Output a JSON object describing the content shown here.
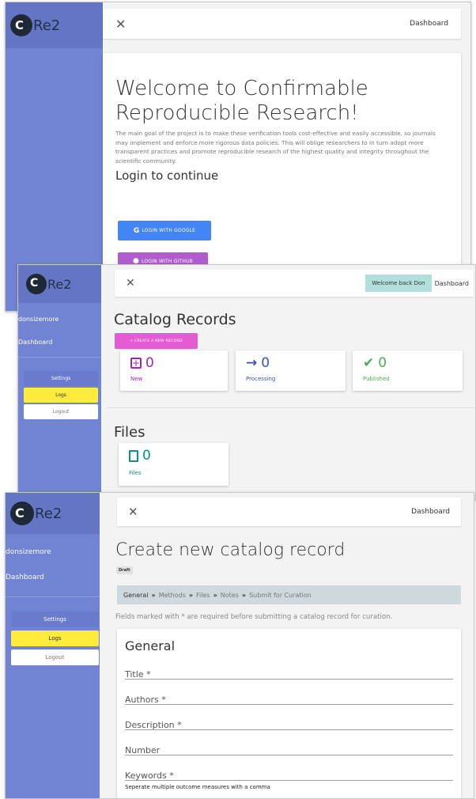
{
  "brand": {
    "name": "Re2",
    "logo_letter": "C"
  },
  "screen1": {
    "topbar": {
      "close_icon": "close-icon",
      "nav_link": "Dashboard"
    },
    "welcome": {
      "title": "Welcome to Confirmable Reproducible Research!",
      "body": "The main goal of the project is to make these verification tools cost-effective and easily accessible, so journals may implement and enforce more rigorous data policies. This will oblige researchers to in turn adopt more transparent practices and promote reproducible research of the highest quality and integrity throughout the scientific community.",
      "login_heading": "Login to continue",
      "google_label": "LOGIN WITH GOOGLE",
      "github_label": "LOGIN WITH GITHUB"
    },
    "colors": {
      "google": "#4285f4",
      "github": "#b05ccd"
    }
  },
  "screen2": {
    "topbar": {
      "welcome_badge": "Welcome back Don",
      "nav_link": "Dashboard"
    },
    "sidebar": {
      "username": "donsizemore",
      "dashboard": "Dashboard",
      "settings": "Settings",
      "logs": "Logs",
      "logout": "Logout"
    },
    "catalog": {
      "title": "Catalog Records",
      "create_button": "+ CREATE A NEW RECORD",
      "stats": [
        {
          "value": "0",
          "label": "New",
          "icon": "plus-square-icon",
          "color": "#9c27b0"
        },
        {
          "value": "0",
          "label": "Processing",
          "icon": "arrow-right-icon",
          "color": "#3f51b5"
        },
        {
          "value": "0",
          "label": "Published",
          "icon": "check-icon",
          "color": "#4caf50"
        }
      ]
    },
    "files": {
      "title": "Files",
      "stat": {
        "value": "0",
        "label": "Files",
        "icon": "file-icon",
        "color": "#009688"
      }
    }
  },
  "screen3": {
    "topbar": {
      "nav_link": "Dashboard"
    },
    "sidebar": {
      "username": "donsizemore",
      "dashboard": "Dashboard",
      "settings": "Settings",
      "logs": "Logs",
      "logout": "Logout"
    },
    "form": {
      "title": "Create new catalog record",
      "status_badge": "Draft",
      "steps": [
        "General",
        "Methods",
        "Files",
        "Notes",
        "Submit for Curation"
      ],
      "step_separator": "»",
      "hint": "Fields marked with * are required before submitting a catalog record for curation.",
      "section_title": "General",
      "fields": [
        {
          "label": "Title *"
        },
        {
          "label": "Authors *"
        },
        {
          "label": "Description *"
        },
        {
          "label": "Number"
        },
        {
          "label": "Keywords *"
        }
      ],
      "keywords_helper": "Seperate multiple outcome measures with a comma"
    }
  }
}
